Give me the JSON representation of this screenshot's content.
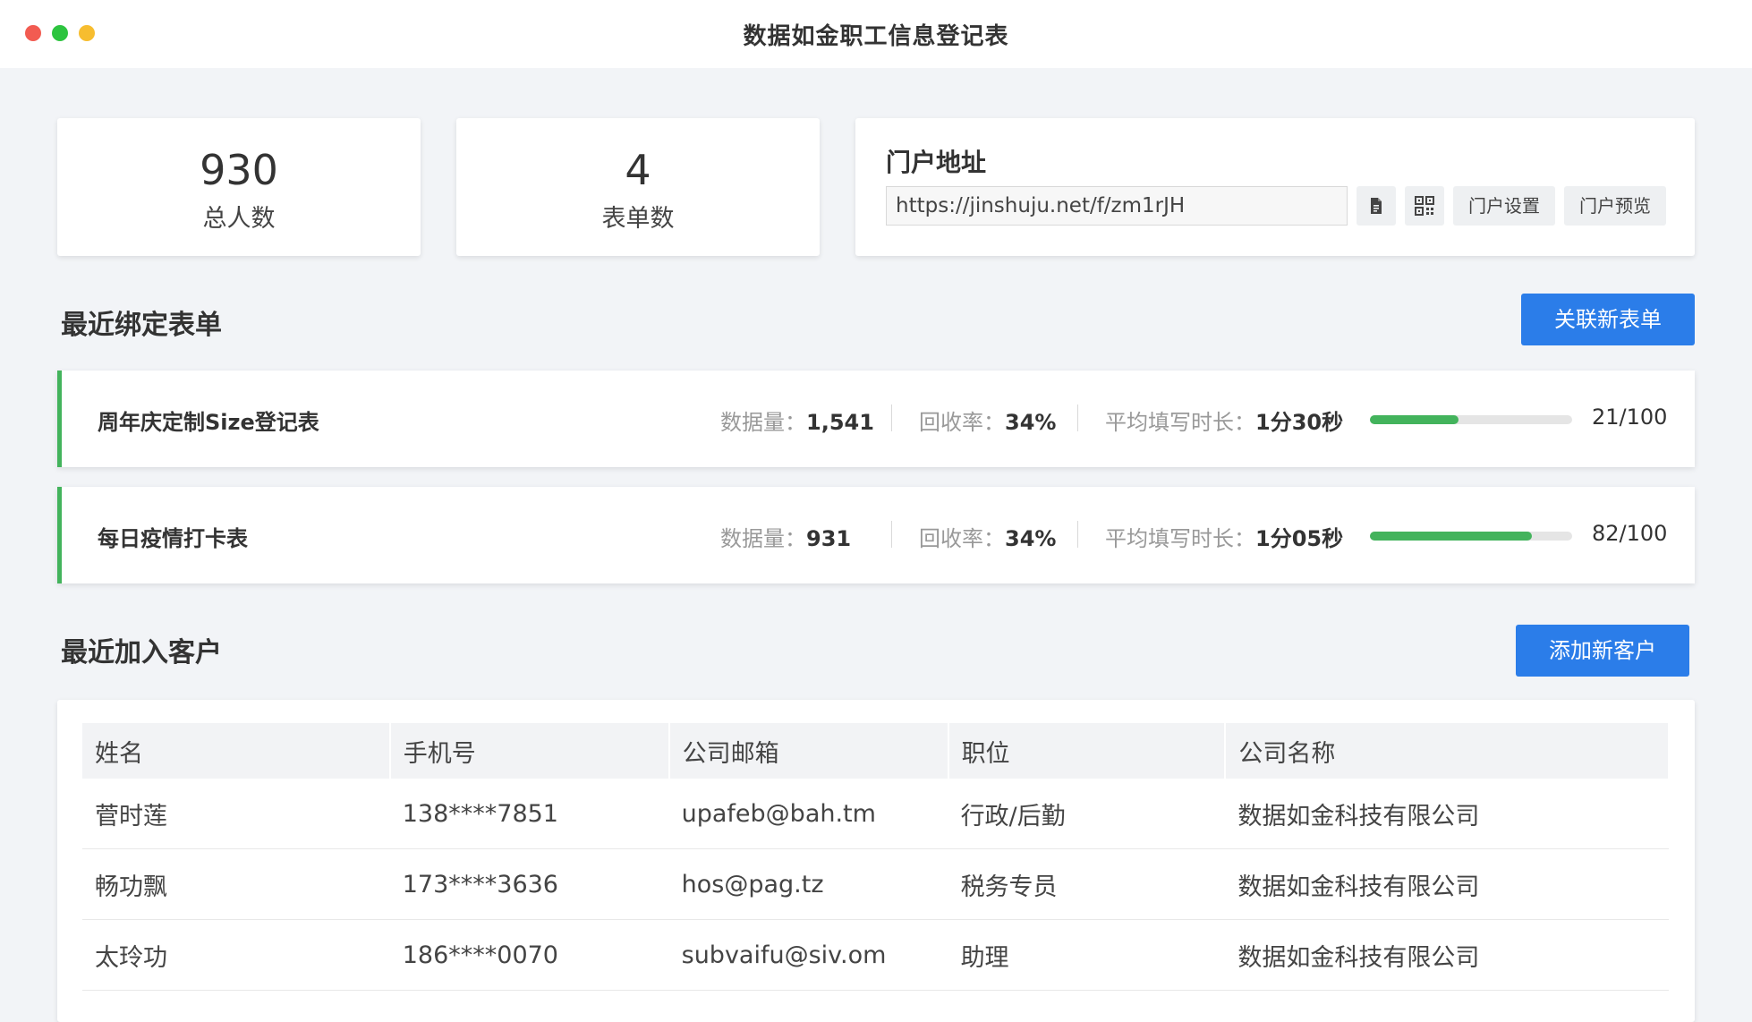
{
  "window": {
    "title": "数据如金职工信息登记表"
  },
  "stats": [
    {
      "value": "930",
      "label": "总人数"
    },
    {
      "value": "4",
      "label": "表单数"
    }
  ],
  "portal": {
    "title": "门户地址",
    "url": "https://jinshuju.net/f/zm1rJH",
    "copy_icon": "document-icon",
    "qr_icon": "qrcode-icon",
    "settings_label": "门户设置",
    "preview_label": "门户预览"
  },
  "forms_section": {
    "title": "最近绑定表单",
    "button_label": "关联新表单",
    "data_label": "数据量：",
    "rate_label": "回收率：",
    "duration_label": "平均填写时长：",
    "items": [
      {
        "name": "周年庆定制Size登记表",
        "data_count": "1,541",
        "rate": "34%",
        "duration": "1分30秒",
        "progress": 0.44,
        "progress_text": "21/100"
      },
      {
        "name": "每日疫情打卡表",
        "data_count": "931",
        "rate": "34%",
        "duration": "1分05秒",
        "progress": 0.8,
        "progress_text": "82/100"
      }
    ]
  },
  "customers_section": {
    "title": "最近加入客户",
    "button_label": "添加新客户",
    "columns": [
      "姓名",
      "手机号",
      "公司邮箱",
      "职位",
      "公司名称"
    ],
    "rows": [
      [
        "菅时莲",
        "138****7851",
        "upafeb@bah.tm",
        "行政/后勤",
        "数据如金科技有限公司"
      ],
      [
        "畅功飘",
        "173****3636",
        "hos@pag.tz",
        "税务专员",
        "数据如金科技有限公司"
      ],
      [
        "太玲功",
        "186****0070",
        "subvaifu@siv.om",
        "助理",
        "数据如金科技有限公司"
      ]
    ]
  },
  "colors": {
    "accent": "#2b7de9",
    "progress": "#43b35c",
    "background": "#f2f4f7"
  }
}
